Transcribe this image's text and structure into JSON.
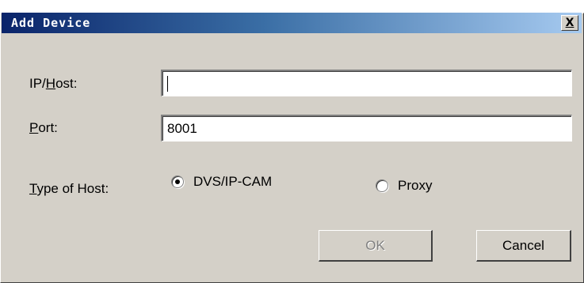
{
  "window": {
    "title": "Add Device",
    "close_label": "X"
  },
  "form": {
    "ip_host": {
      "label_prefix": "IP/",
      "label_mnemonic": "H",
      "label_suffix": "ost:",
      "value": ""
    },
    "port": {
      "label_mnemonic": "P",
      "label_suffix": "ort:",
      "value": "8001"
    },
    "host_type": {
      "label_mnemonic": "T",
      "label_suffix": "ype of Host:",
      "options": [
        {
          "label": "DVS/IP-CAM",
          "selected": true
        },
        {
          "label": "Proxy",
          "selected": false
        }
      ]
    }
  },
  "buttons": {
    "ok_label": "OK",
    "ok_enabled": false,
    "cancel_label": "Cancel"
  },
  "colors": {
    "dialog_bg": "#d4d0c8",
    "title_start": "#0a246a",
    "title_end": "#a6caf0"
  }
}
